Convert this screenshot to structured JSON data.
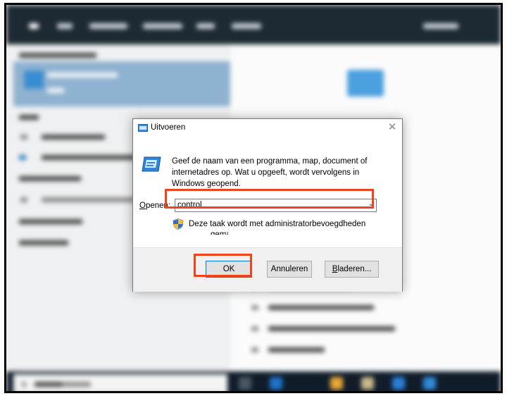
{
  "dialog": {
    "title": "Uitvoeren",
    "close_symbol": "✕",
    "description": "Geef de naam van een programma, map, document of internetadres op. Wat u opgeeft, wordt vervolgens in Windows geopend.",
    "open_label_prefix": "O",
    "open_label_rest": "penen:",
    "input_value": "control",
    "dropdown_symbol": "⌄",
    "admin_notice": "Deze taak wordt met administratorbevoegdheden",
    "admin_notice_cont": "gemaakt.",
    "buttons": {
      "ok": "OK",
      "cancel": "Annuleren",
      "browse_prefix": "B",
      "browse_rest": "laderen..."
    }
  },
  "icons": [
    "run-dialog-icon",
    "run-program-icon",
    "uac-shield-icon",
    "close-icon",
    "dropdown-arrow-icon"
  ],
  "colors": {
    "highlight": "#f0441f",
    "ok_button_border": "#0078d7",
    "background_topbar": "#1d2a33",
    "taskbar": "#101c2a"
  }
}
